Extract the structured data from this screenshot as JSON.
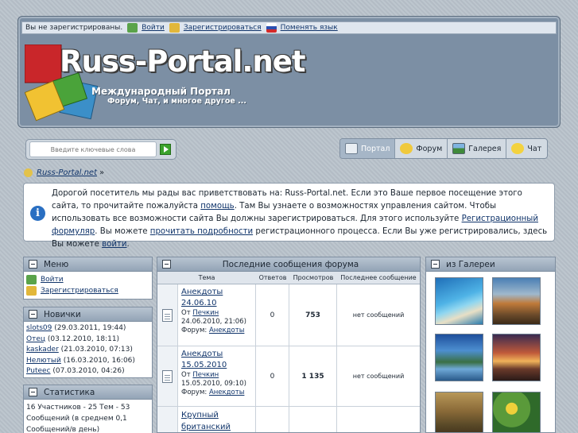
{
  "topbar": {
    "not_registered": "Вы не зарегистрированы.",
    "login": "Войти",
    "register": "Зарегистрироваться",
    "change_lang": "Поменять язык"
  },
  "logo": {
    "title": "Russ-Portal.net",
    "subtitle": "Международный Портал",
    "tagline": "Форум, Чат, и многое другое ..."
  },
  "search": {
    "placeholder": "Введите ключевые слова"
  },
  "nav": {
    "tabs": [
      {
        "label": "Портал",
        "icon": "portal-icon",
        "color": "#e9eef3"
      },
      {
        "label": "Форум",
        "icon": "forum-icon",
        "color": "#f0c93c"
      },
      {
        "label": "Галерея",
        "icon": "gallery-icon",
        "color": "#3f8a3b"
      },
      {
        "label": "Чат",
        "icon": "chat-icon",
        "color": "#f3d23f"
      }
    ]
  },
  "breadcrumb": {
    "home": "Russ-Portal.net",
    "separator": "»"
  },
  "welcome": {
    "p1": "Дорогой посетитель мы рады вас приветствовать на: Russ-Portal.net. Если это Ваше первое посещение этого сайта, то прочитайте пожалуйста ",
    "link1": "помощь",
    "p2": ". Там Вы узнаете о возможностях управления сайтом. Чтобы использовать все возможности сайта Вы должны зарегистрироваться. Для этого используйте ",
    "link2": "Регистрационный формуляр",
    "p3": ". Вы можете ",
    "link3": "прочитать подробности",
    "p4": " регистрационного процесса. Если Вы уже регистрировались, здесь Вы можете ",
    "link4": "войти",
    "p5": "."
  },
  "menu": {
    "title": "Меню",
    "login": "Войти",
    "register": "Зарегистрироваться"
  },
  "newbies": {
    "title": "Новички",
    "items": [
      {
        "name": "slots09",
        "date": " (29.03.2011, 19:44)"
      },
      {
        "name": "Отец",
        "date": " (03.12.2010, 18:11)"
      },
      {
        "name": "kaskader",
        "date": " (21.03.2010, 07:13)"
      },
      {
        "name": "Нелютый",
        "date": " (16.03.2010, 16:06)"
      },
      {
        "name": "Putеес",
        "date": " (07.03.2010, 04:26)"
      }
    ]
  },
  "stats": {
    "title": "Статистика",
    "line1": "16 Участников - 25 Тем - 53",
    "line2": "Сообщений (в среднем 0,1",
    "line3": "Сообщений/в день)"
  },
  "forum": {
    "title": "Последние сообщения форума",
    "columns": {
      "theme": "Тема",
      "answers": "Ответов",
      "views": "Просмотров",
      "last": "Последнее сообщение"
    },
    "rows": [
      {
        "title": "Анекдоты 24.06.10",
        "from_label": "От",
        "author": "Печкин",
        "date": "24.06.2010, 21:06)",
        "forum_label": "Форум:",
        "forum": "Анекдоты",
        "answers": "0",
        "views": "753",
        "last": "нет сообщений"
      },
      {
        "title": "Анекдоты 15.05.2010",
        "from_label": "От",
        "author": "Печкин",
        "date": "15.05.2010, 09:10)",
        "forum_label": "Форум:",
        "forum": "Анекдоты",
        "answers": "0",
        "views": "1 135",
        "last": "нет сообщений"
      },
      {
        "title": "Крупный британский",
        "from_label": "",
        "author": "",
        "date": "",
        "forum_label": "",
        "forum": "",
        "answers": "",
        "views": "",
        "last": ""
      }
    ]
  },
  "gallery": {
    "title": "из Галереи"
  }
}
